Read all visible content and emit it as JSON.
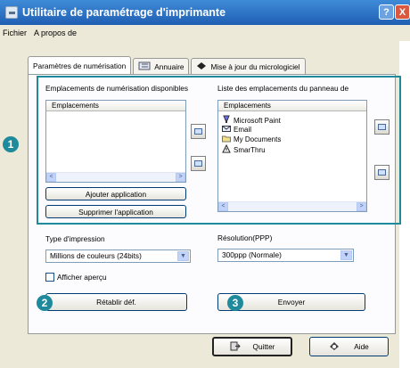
{
  "title": "Utilitaire de paramétrage d'imprimante",
  "window_controls": {
    "help": "?",
    "close": "X"
  },
  "menu": [
    "Fichier",
    "A propos de"
  ],
  "tabs": [
    {
      "label": "Paramètres de numérisation",
      "icon": "scan-settings-icon",
      "active": true
    },
    {
      "label": "Annuaire",
      "icon": "address-book-icon",
      "active": false
    },
    {
      "label": "Mise à jour du micrologiciel",
      "icon": "firmware-icon",
      "active": false
    }
  ],
  "left_section": {
    "title": "Emplacements de numérisation disponibles",
    "column_header": "Emplacements",
    "items": []
  },
  "right_section": {
    "title": "Liste des emplacements du panneau de",
    "column_header": "Emplacements",
    "items": [
      "Microsoft Paint",
      "Email",
      "My Documents",
      "SmarThru"
    ]
  },
  "buttons": {
    "add_app": "Ajouter application",
    "remove_app": "Supprimer l'application",
    "reset": "Rétablir déf.",
    "send": "Envoyer",
    "quit": "Quitter",
    "help": "Aide"
  },
  "scan_type": {
    "label": "Type d'impression",
    "value": "Millions de couleurs (24bits)"
  },
  "resolution": {
    "label": "Résolution(PPP)",
    "value": "300ppp (Normale)"
  },
  "preview_checkbox": {
    "label": "Afficher aperçu",
    "checked": false
  },
  "callouts": [
    "1",
    "2",
    "3"
  ],
  "accent_color": "#1e8a9b"
}
